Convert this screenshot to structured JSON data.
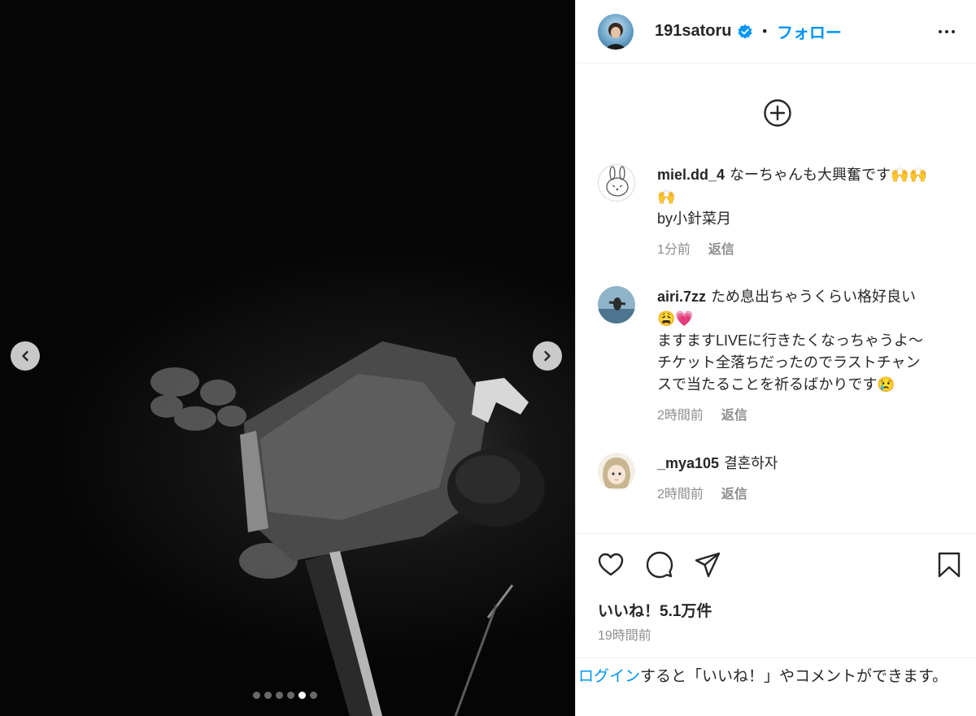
{
  "post": {
    "media": {
      "carousel_dots": 6,
      "active_dot_index": 4,
      "prev_icon": "chevron-left-icon",
      "next_icon": "chevron-right-icon"
    },
    "header": {
      "username": "191satoru",
      "verified": true,
      "separator": "•",
      "follow_label": "フォロー",
      "more_icon": "more-horizontal-icon"
    },
    "load_more_icon": "plus-circle-icon",
    "comments": [
      {
        "username": "miel.dd_4",
        "lines": [
          "なーちゃんも大興奮です🙌🙌",
          "🙌",
          "by小針菜月"
        ],
        "time": "1分前",
        "reply_label": "返信"
      },
      {
        "username": "airi.7zz",
        "lines": [
          "ため息出ちゃうくらい格好良い",
          "😩💗",
          "ますますLIVEに行きたくなっちゃうよ〜",
          "チケット全落ちだったのでラストチャン",
          "スで当たることを祈るばかりです😢"
        ],
        "time": "2時間前",
        "reply_label": "返信"
      },
      {
        "username": "_mya105",
        "lines": [
          "결혼하자"
        ],
        "time": "2時間前",
        "reply_label": "返信"
      }
    ],
    "actions": {
      "like_icon": "heart-icon",
      "comment_icon": "comment-icon",
      "share_icon": "send-icon",
      "save_icon": "bookmark-icon"
    },
    "likes_text": "いいね！5.1万件",
    "posted_time": "19時間前",
    "login_prompt": {
      "link_text": "ログイン",
      "rest_text": "すると「いいね！」やコメントができます。"
    },
    "colors": {
      "accent": "#0095f6",
      "text": "#262626",
      "muted": "#8e8e8e",
      "divider": "#efefef"
    }
  }
}
